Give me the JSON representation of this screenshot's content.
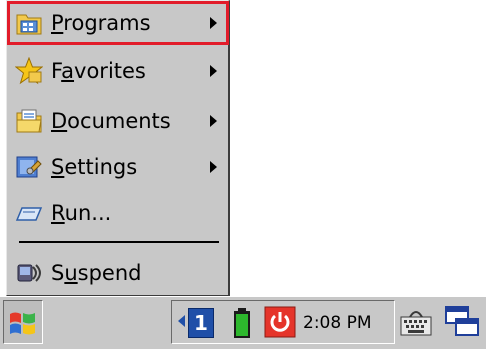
{
  "menu": {
    "items": [
      {
        "label": "Programs",
        "accel": "P",
        "rest": "rograms"
      },
      {
        "label": "Favorites",
        "pre": "F",
        "accel": "a",
        "rest": "vorites"
      },
      {
        "label": "Documents",
        "accel": "D",
        "rest": "ocuments"
      },
      {
        "label": "Settings",
        "accel": "S",
        "rest": "ettings"
      },
      {
        "label": "Run...",
        "accel": "R",
        "rest": "un..."
      },
      {
        "label": "Suspend",
        "pre": "S",
        "accel": "u",
        "rest": "spend"
      }
    ]
  },
  "taskbar": {
    "input_indicator": "1",
    "clock": "2:08 PM"
  },
  "colors": {
    "highlight_border": "#e21c2a",
    "menu_bg": "#c8c8c8",
    "battery_green": "#2db82d",
    "power_red": "#e5342a"
  }
}
